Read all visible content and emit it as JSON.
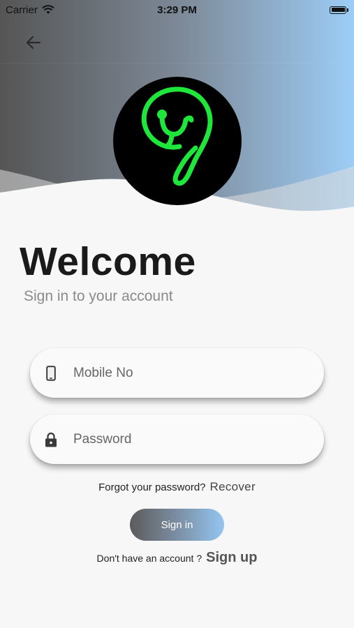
{
  "status_bar": {
    "carrier": "Carrier",
    "time": "3:29 PM"
  },
  "appbar": {
    "back_icon": "arrow-left-icon"
  },
  "logo": {
    "icon": "stethoscope-9-logo",
    "accent_color": "#1ee63a"
  },
  "header": {
    "title": "Welcome",
    "subtitle": "Sign in to your account"
  },
  "form": {
    "mobile_placeholder": "Mobile No",
    "mobile_icon": "phone-icon",
    "password_placeholder": "Password",
    "password_icon": "lock-icon"
  },
  "forgot": {
    "prompt": "Forgot your password?",
    "link": "Recover"
  },
  "signin": {
    "label": "Sign in"
  },
  "signup": {
    "prompt": "Don't have an account ?",
    "link": "Sign up"
  },
  "colors": {
    "gradient_start": "#555555",
    "gradient_end": "#9ccdf6",
    "background": "#f7f7f7"
  }
}
